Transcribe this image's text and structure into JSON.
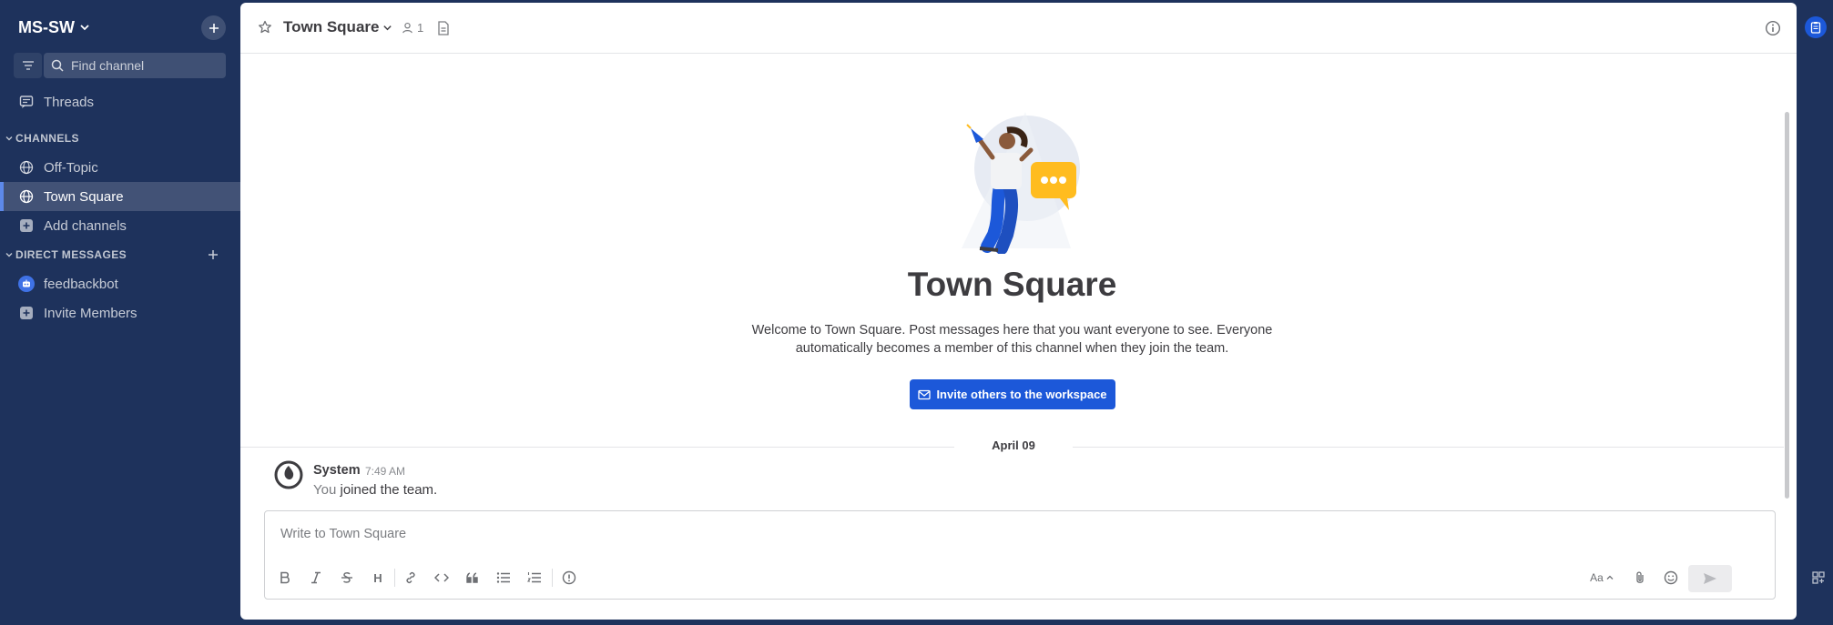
{
  "sidebar": {
    "team_name": "MS-SW",
    "find_channel_placeholder": "Find channel",
    "threads_label": "Threads",
    "channels_header": "CHANNELS",
    "channels": [
      {
        "label": "Off-Topic",
        "active": false
      },
      {
        "label": "Town Square",
        "active": true
      }
    ],
    "add_channels_label": "Add channels",
    "dm_header": "DIRECT MESSAGES",
    "dms": [
      {
        "label": "feedbackbot"
      }
    ],
    "invite_members_label": "Invite Members"
  },
  "header": {
    "channel_name": "Town Square",
    "member_count": "1"
  },
  "intro": {
    "title": "Town Square",
    "description": "Welcome to Town Square. Post messages here that you want everyone to see. Everyone automatically becomes a member of this channel when they join the team.",
    "invite_button": "Invite others to the workspace"
  },
  "feed": {
    "date_separator": "April 09",
    "post": {
      "user": "System",
      "time": "7:49 AM",
      "message_prefix": "You",
      "message_rest": "joined the team."
    }
  },
  "composer": {
    "placeholder": "Write to Town Square",
    "format_heading": "H",
    "format_text_size": "Aa"
  },
  "colors": {
    "sidebar_bg": "#1e325c",
    "accent": "#1c58d9",
    "active_indicator": "#5d89ea"
  }
}
